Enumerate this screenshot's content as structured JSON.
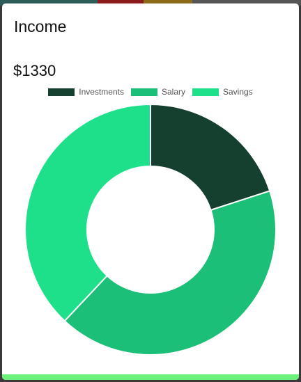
{
  "card": {
    "title": "Income",
    "amount": "$1330"
  },
  "chart_data": {
    "type": "pie",
    "variant": "doughnut",
    "categories": [
      "Investments",
      "Salary",
      "Savings"
    ],
    "values": [
      0.2,
      0.42,
      0.38
    ],
    "colors": [
      "#153f2f",
      "#1bbf77",
      "#1ee08a"
    ],
    "legend": "top"
  },
  "colors": {
    "bottom_bar": "#6cf27a",
    "background_strips": [
      "#2e5c58",
      "#8b1a1a",
      "#8b6a1a",
      "#555555"
    ]
  }
}
